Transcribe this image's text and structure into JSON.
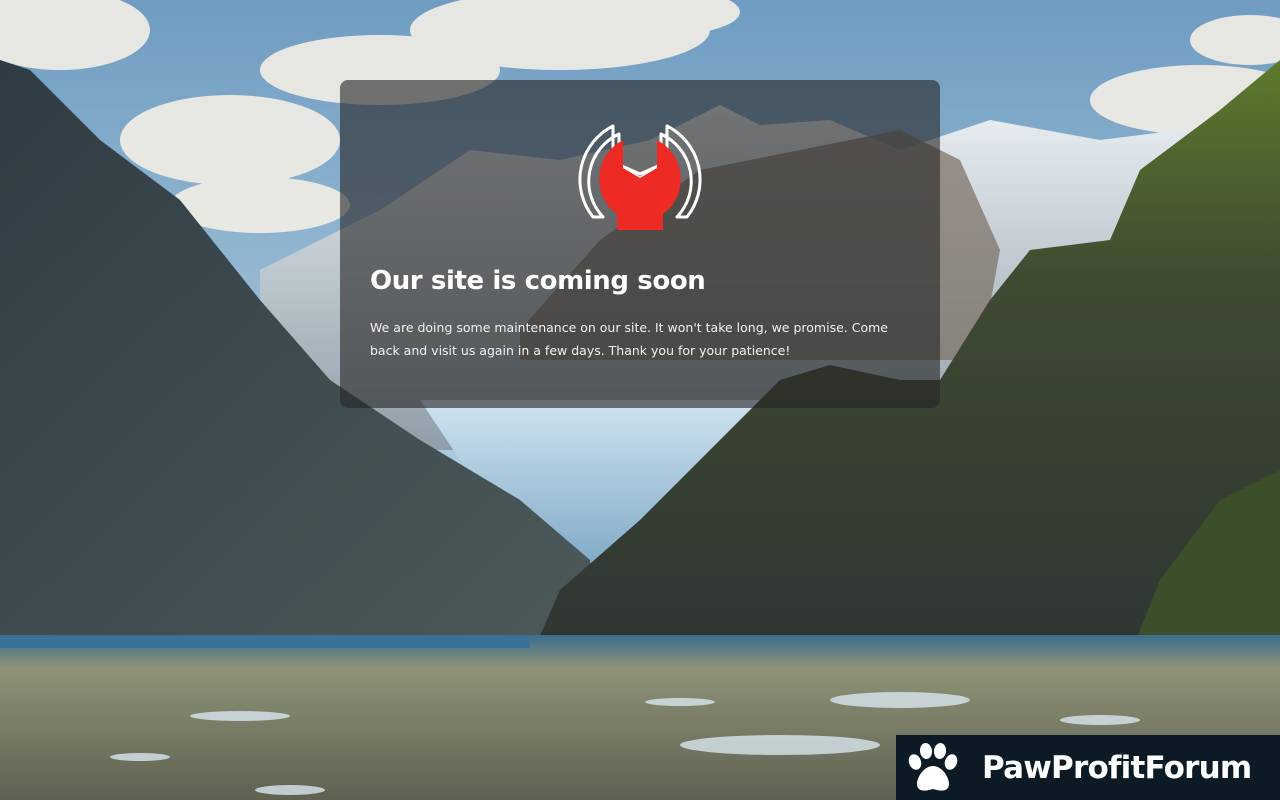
{
  "maintenance": {
    "title": "Our site is coming soon",
    "message": "We are doing some maintenance on our site. It won't take long, we promise. Come back and visit us again in a few days. Thank you for your patience!",
    "logo_icon": "wrench-icon",
    "logo_color": "#ee2a24"
  },
  "watermark": {
    "name": "PawProfitForum",
    "icon": "paw-icon",
    "background": "#0b1a24"
  },
  "background": {
    "description_icon": "mountain-fjord-background"
  }
}
